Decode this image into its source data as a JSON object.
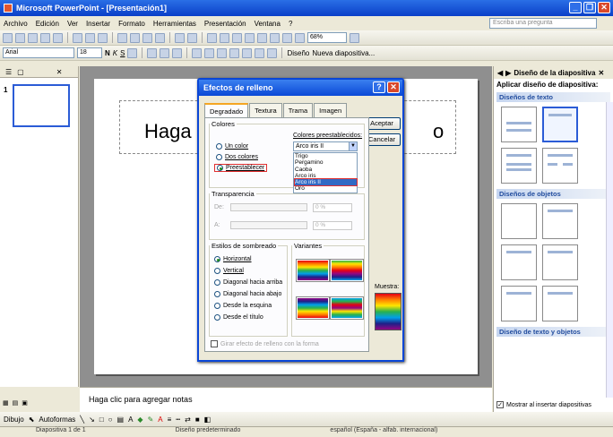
{
  "window": {
    "title": "Microsoft PowerPoint - [Presentación1]"
  },
  "menu": {
    "items": [
      "Archivo",
      "Edición",
      "Ver",
      "Insertar",
      "Formato",
      "Herramientas",
      "Presentación",
      "Ventana",
      "?"
    ],
    "help_placeholder": "Escriba una pregunta"
  },
  "toolbar": {
    "zoom": "68%",
    "font": "Arial",
    "size": "18",
    "bold": "N",
    "italic": "K",
    "underline": "S",
    "design_label": "Diseño",
    "new_slide_label": "Nueva diapositiva..."
  },
  "slide": {
    "title_part1": "Haga",
    "title_part2": "o"
  },
  "notes": {
    "placeholder": "Haga clic para agregar notas"
  },
  "drawbar": {
    "draw_label": "Dibujo",
    "autoshapes_label": "Autoformas"
  },
  "statusbar": {
    "slide": "Diapositiva 1 de 1",
    "design": "Diseño predeterminado",
    "language": "español (España - alfab. internacional)"
  },
  "taskpane": {
    "title": "Diseño de la diapositiva",
    "subtitle": "Aplicar diseño de diapositiva:",
    "sections": [
      "Diseños de texto",
      "Diseños de objetos",
      "Diseño de texto y objetos"
    ],
    "show_on_insert": "Mostrar al insertar diapositivas"
  },
  "dialog": {
    "title": "Efectos de relleno",
    "tabs": [
      "Degradado",
      "Textura",
      "Trama",
      "Imagen"
    ],
    "accept": "Aceptar",
    "cancel": "Cancelar",
    "colors_group": "Colores",
    "radio_one": "Un color",
    "radio_two": "Dos colores",
    "radio_preset": "Preestablecer",
    "preset_label": "Colores preestablecidos:",
    "preset_selected": "Arco iris II",
    "preset_options": [
      "Trigo",
      "Pergamino",
      "Caoba",
      "Arco iris",
      "Arco iris II",
      "Oro"
    ],
    "transparency_group": "Transparencia",
    "from_label": "De:",
    "to_label": "A:",
    "pct_from": "0 %",
    "pct_to": "0 %",
    "shading_group": "Estilos de sombreado",
    "variants_group": "Variantes",
    "styles": [
      "Horizontal",
      "Vertical",
      "Diagonal hacia arriba",
      "Diagonal hacia abajo",
      "Desde la esquina",
      "Desde el título"
    ],
    "sample_label": "Muestra:",
    "rotate_label": "Girar efecto de relleno con la forma"
  },
  "colors": {
    "accent": "#0a46d6",
    "highlight": "#e03030"
  }
}
